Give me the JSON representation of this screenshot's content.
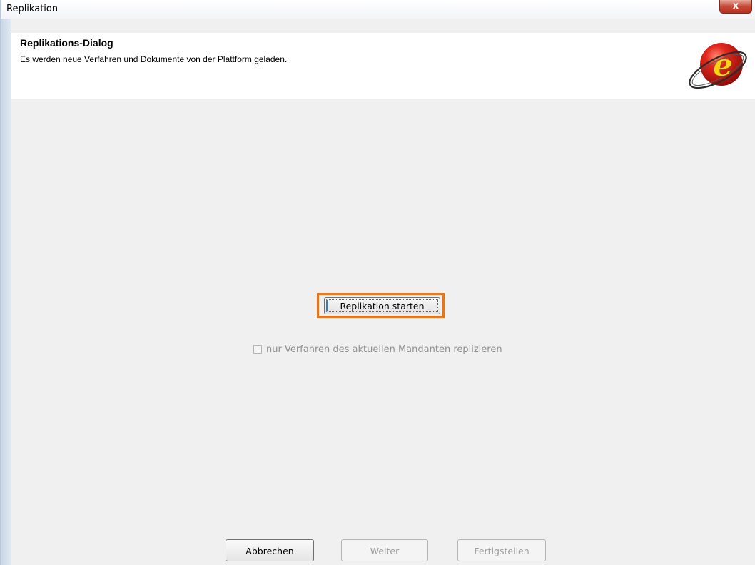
{
  "window": {
    "title": "Replikation",
    "close_label": "x"
  },
  "header": {
    "title": "Replikations-Dialog",
    "subtitle": "Es werden neue Verfahren und Dokumente von der Plattform geladen.",
    "logo_letter": "e"
  },
  "main": {
    "start_button_label": "Replikation starten",
    "checkbox_label": "nur Verfahren des aktuellen Mandanten replizieren",
    "checkbox_checked": false,
    "checkbox_enabled": false
  },
  "footer": {
    "cancel_label": "Abbrechen",
    "next_label": "Weiter",
    "finish_label": "Fertigstellen"
  },
  "colors": {
    "highlight": "#e8741e",
    "logo_red": "#d9201c"
  }
}
